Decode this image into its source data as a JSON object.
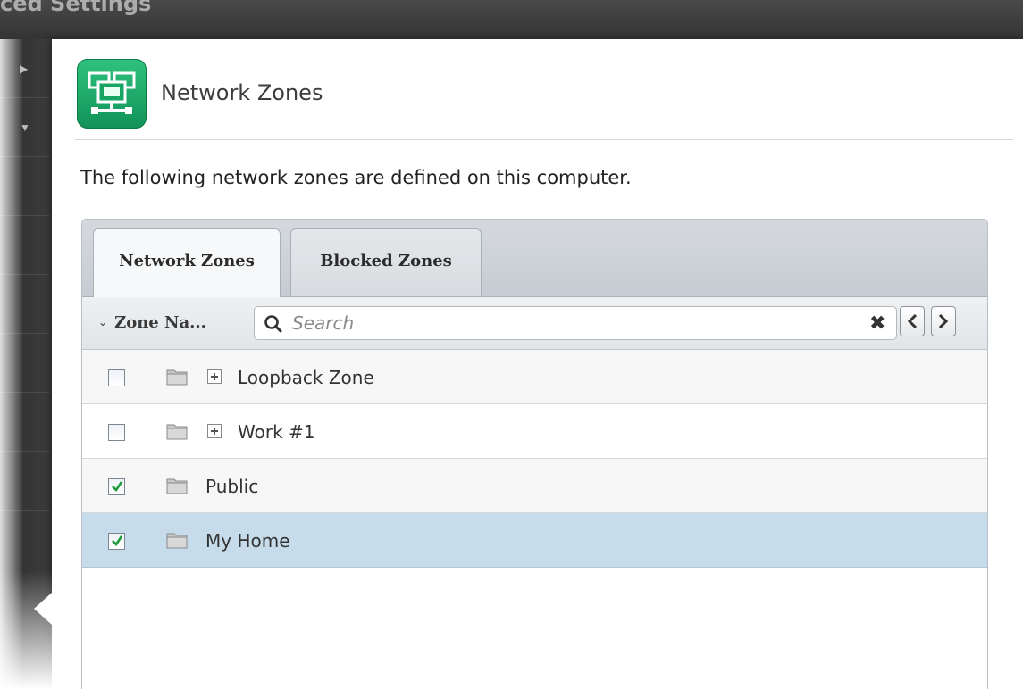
{
  "window": {
    "title_ghost": "ced Settings"
  },
  "header": {
    "icon": "network-monitor-icon",
    "title": "Network Zones",
    "accent": "#1fa86a"
  },
  "intro_text": "The following network zones are defined on this computer.",
  "tabs": [
    {
      "label": "Network Zones",
      "active": true
    },
    {
      "label": "Blocked Zones",
      "active": false
    }
  ],
  "toolbar": {
    "sort_column": "Zone Na...",
    "search_placeholder": "Search",
    "search_value": ""
  },
  "zones": [
    {
      "name": "Loopback Zone",
      "checked": false,
      "expandable": true,
      "selected": false
    },
    {
      "name": "Work #1",
      "checked": false,
      "expandable": true,
      "selected": false
    },
    {
      "name": "Public",
      "checked": true,
      "expandable": false,
      "selected": false
    },
    {
      "name": "My Home",
      "checked": true,
      "expandable": false,
      "selected": true
    }
  ],
  "colors": {
    "selected_row": "#c7dcea",
    "check_mark": "#1e9a3c"
  }
}
